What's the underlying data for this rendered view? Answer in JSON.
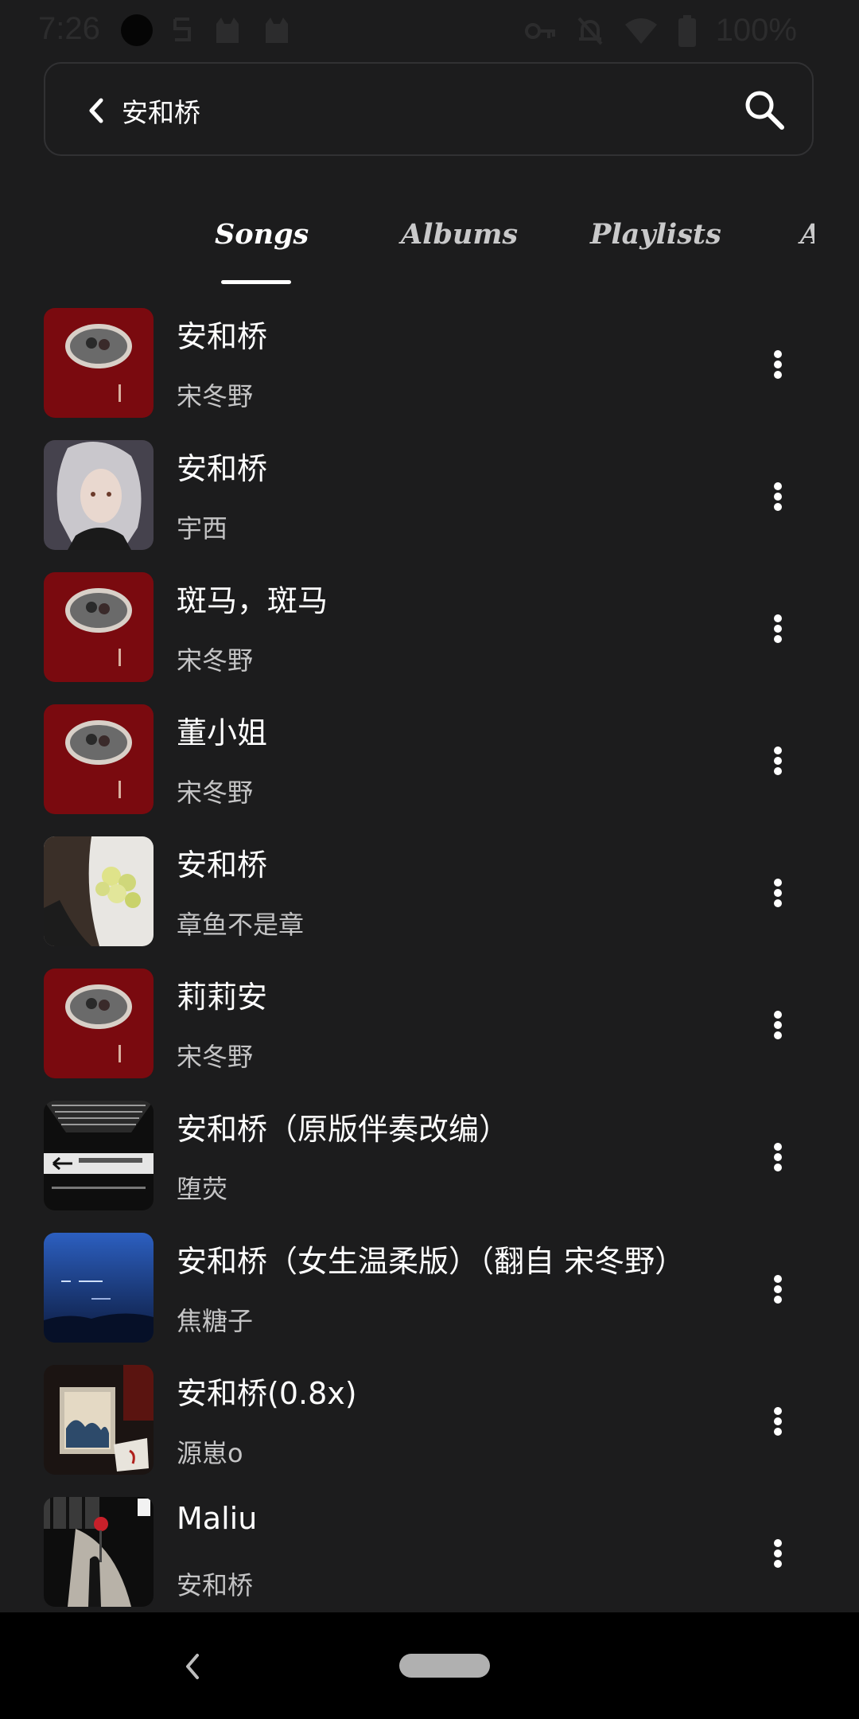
{
  "status_bar": {
    "time": "7:26",
    "battery": "100%"
  },
  "search": {
    "query": "安和桥"
  },
  "tabs": [
    {
      "label": "Songs",
      "active": true
    },
    {
      "label": "Albums",
      "active": false
    },
    {
      "label": "Playlists",
      "active": false
    },
    {
      "label": "Artists",
      "active": false
    }
  ],
  "songs": [
    {
      "title": "安和桥",
      "artist": "宋冬野",
      "cover": "red-album-cover"
    },
    {
      "title": "安和桥",
      "artist": "宇西",
      "cover": "anime-girl-cover"
    },
    {
      "title": "斑马，斑马",
      "artist": "宋冬野",
      "cover": "red-album-cover"
    },
    {
      "title": "董小姐",
      "artist": "宋冬野",
      "cover": "red-album-cover"
    },
    {
      "title": "安和桥",
      "artist": "章鱼不是章",
      "cover": "flowers-cover"
    },
    {
      "title": "莉莉安",
      "artist": "宋冬野",
      "cover": "red-album-cover"
    },
    {
      "title": "安和桥（原版伴奏改编）",
      "artist": "堕荧",
      "cover": "subway-sign-cover"
    },
    {
      "title": "安和桥（女生温柔版）（翻自 宋冬野）",
      "artist": "焦糖子",
      "cover": "blue-sky-cover"
    },
    {
      "title": "安和桥(0.8x)",
      "artist": "源崽o",
      "cover": "wave-painting-cover"
    },
    {
      "title": "Maliu",
      "artist": "安和桥",
      "cover": "night-street-cover"
    }
  ],
  "colors": {
    "background": "#1c1c1d",
    "text_primary": "#ffffff",
    "text_secondary": "#c4c4c5",
    "album_red": "#7a0a0f"
  }
}
